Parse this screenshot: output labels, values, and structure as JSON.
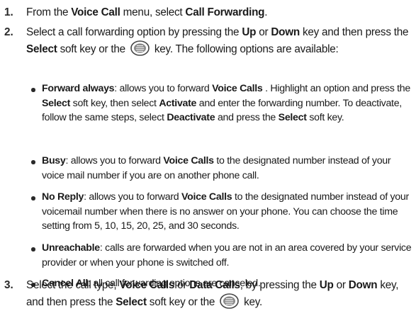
{
  "steps": [
    {
      "number": "1.",
      "parts": [
        {
          "t": "From the "
        },
        {
          "t": "Voice Call",
          "b": true
        },
        {
          "t": " menu, select "
        },
        {
          "t": "Call Forwarding",
          "b": true
        },
        {
          "t": "."
        }
      ]
    },
    {
      "number": "2.",
      "parts": [
        {
          "t": "Select a call forwarding option by pressing the "
        },
        {
          "t": "Up",
          "b": true
        },
        {
          "t": " or "
        },
        {
          "t": "Down",
          "b": true
        },
        {
          "t": " key and then press the "
        },
        {
          "t": "Select",
          "b": true
        },
        {
          "t": " soft key or the "
        },
        {
          "icon": "select-key-icon"
        },
        {
          "t": " key. The following options are available:"
        }
      ],
      "bullets": [
        [
          {
            "t": "Forward always",
            "b": true
          },
          {
            "t": ": allows you to forward "
          },
          {
            "t": "Voice Calls",
            "b": true
          },
          {
            "t": " . Highlight an option and press the "
          },
          {
            "t": "Select",
            "b": true
          },
          {
            "t": " soft key, then select "
          },
          {
            "t": "Activate",
            "b": true
          },
          {
            "t": " and enter the forwarding number. To deactivate, follow the same steps, select "
          },
          {
            "t": "Deactivate",
            "b": true
          },
          {
            "t": " and press the "
          },
          {
            "t": "Select",
            "b": true
          },
          {
            "t": " soft key."
          }
        ],
        [
          {
            "t": "Busy",
            "b": true
          },
          {
            "t": ": allows you to forward "
          },
          {
            "t": "Voice Calls",
            "b": true
          },
          {
            "t": "  to the designated number instead of your voice mail number if you are on another phone call."
          }
        ],
        [
          {
            "t": "No Reply",
            "b": true
          },
          {
            "t": ": allows you to forward "
          },
          {
            "t": "Voice Calls",
            "b": true
          },
          {
            "t": "  to the designated number instead of your voicemail number when there is no answer on your phone. You can choose the time setting from 5, 10, 15, 20, 25, and 30 seconds."
          }
        ],
        [
          {
            "t": "Unreachable",
            "b": true
          },
          {
            "t": ": calls are forwarded when you are not in an area covered by your service provider or when your phone is switched off."
          }
        ],
        [
          {
            "t": "Cancel All",
            "b": true
          },
          {
            "t": ": all call forwarding options are canceled."
          }
        ]
      ]
    },
    {
      "number": "3.",
      "parts": [
        {
          "t": "Select the call type, "
        },
        {
          "t": "Voice Calls",
          "b": true
        },
        {
          "t": " or "
        },
        {
          "t": "Data Calls",
          "b": true
        },
        {
          "t": ", by pressing the "
        },
        {
          "t": "Up",
          "b": true
        },
        {
          "t": " or "
        },
        {
          "t": "Down",
          "b": true
        },
        {
          "t": " key, and then press the "
        },
        {
          "t": "Select",
          "b": true
        },
        {
          "t": " soft key or the "
        },
        {
          "icon": "select-key-icon"
        },
        {
          "t": " key."
        }
      ]
    }
  ]
}
